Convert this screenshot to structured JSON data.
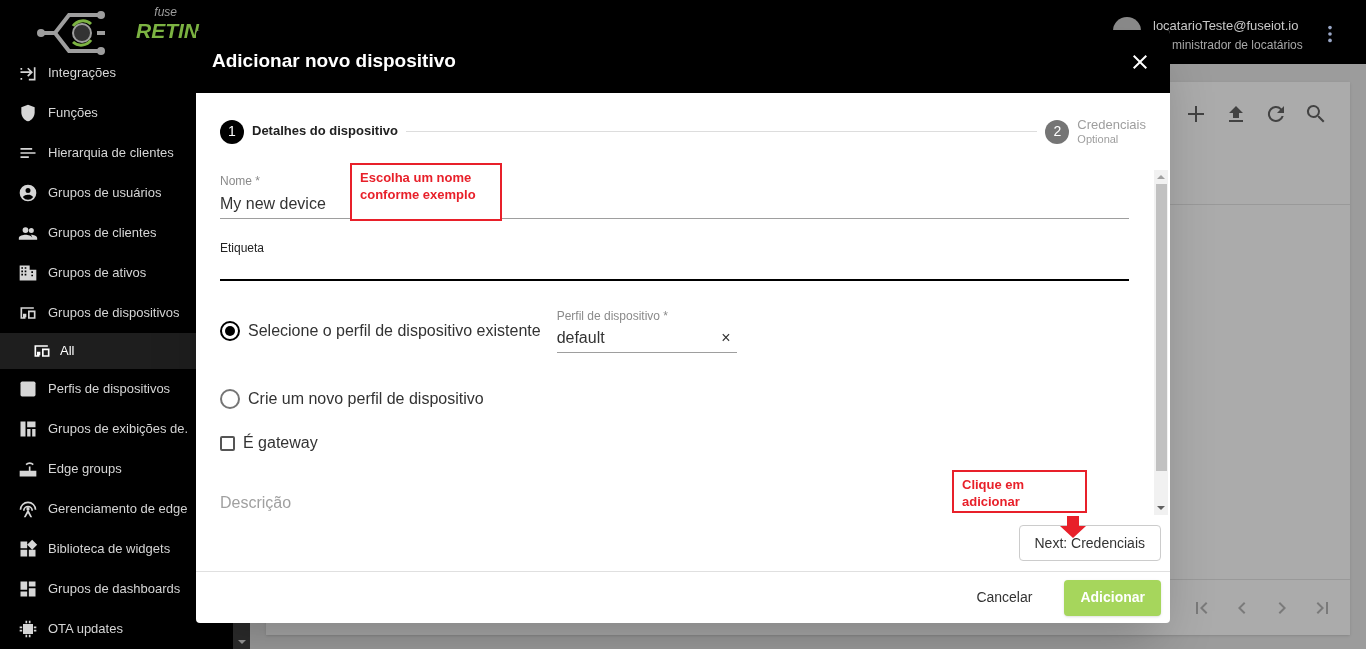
{
  "app_bar": {
    "logo": {
      "small": "fuse",
      "large": "RETIN"
    },
    "user": {
      "email": "locatarioTeste@fuseiot.io",
      "role": "ministrador de locatários"
    }
  },
  "sidebar": {
    "items": [
      {
        "label": "Integrações",
        "selected": false
      },
      {
        "label": "Funções",
        "selected": false
      },
      {
        "label": "Hierarquia de clientes",
        "selected": false
      },
      {
        "label": "Grupos de usuários",
        "selected": false
      },
      {
        "label": "Grupos de clientes",
        "selected": false
      },
      {
        "label": "Grupos de ativos",
        "selected": false
      },
      {
        "label": "Grupos de dispositivos",
        "selected": false,
        "expanded": true,
        "children": [
          {
            "label": "All",
            "selected": true
          }
        ]
      },
      {
        "label": "Perfis de dispositivos",
        "selected": false
      },
      {
        "label": "Grupos de exibições de.",
        "selected": false
      },
      {
        "label": "Edge groups",
        "selected": false
      },
      {
        "label": "Gerenciamento de edge",
        "selected": false
      },
      {
        "label": "Biblioteca de widgets",
        "selected": false
      },
      {
        "label": "Grupos de dashboards",
        "selected": false
      },
      {
        "label": "OTA updates",
        "selected": false
      }
    ]
  },
  "dialog": {
    "title": "Adicionar novo dispositivo",
    "steps": [
      {
        "number": "1",
        "label": "Detalhes do dispositivo",
        "selected": true
      },
      {
        "number": "2",
        "label": "Credenciais",
        "hint": "Optional",
        "selected": false
      }
    ],
    "name_field": {
      "label": "Nome *",
      "value": "My new device"
    },
    "label_field": {
      "label": "Etiqueta",
      "focused": true
    },
    "profile_options": [
      {
        "label": "Selecione o perfil de dispositivo existente",
        "selected": true,
        "select": {
          "label": "Perfil de dispositivo *",
          "value": "default",
          "clear": "×"
        }
      },
      {
        "label": "Crie um novo perfil de dispositivo",
        "selected": false
      }
    ],
    "gateway": {
      "label": "É gateway",
      "checked": false
    },
    "description": {
      "placeholder": "Descrição"
    },
    "next_button": "Next: Credenciais",
    "cancel_button": "Cancelar",
    "add_button": "Adicionar",
    "annotations": [
      {
        "text": "Escolha um nome conforme exemplo"
      },
      {
        "text": "Clique em adicionar"
      }
    ]
  }
}
